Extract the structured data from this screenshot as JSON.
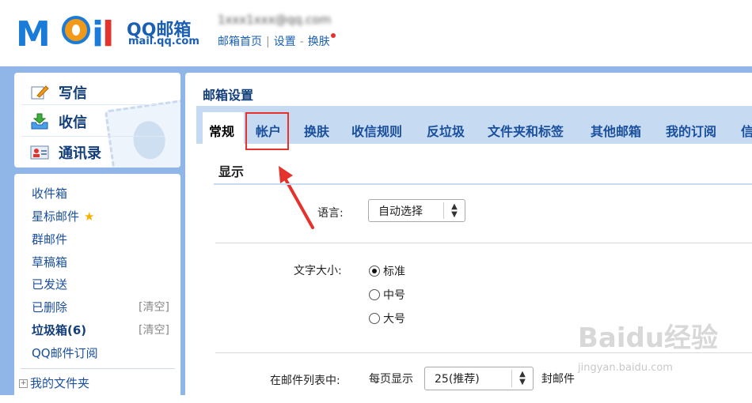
{
  "header": {
    "logo_text": "Mail",
    "brand_name": "QQ邮箱",
    "brand_domain": "mail.qq.com",
    "account": "1xxx1xxx@qq.com",
    "links": [
      "邮箱首页",
      "设置",
      "换肤"
    ]
  },
  "sidebar": {
    "quick": [
      {
        "label": "写信",
        "icon": "compose-icon"
      },
      {
        "label": "收信",
        "icon": "inbox-download-icon"
      },
      {
        "label": "通讯录",
        "icon": "contacts-icon"
      }
    ],
    "folders": [
      {
        "label": "收件箱"
      },
      {
        "label": "星标邮件"
      },
      {
        "label": "群邮件"
      },
      {
        "label": "草稿箱"
      },
      {
        "label": "已发送"
      },
      {
        "label": "已删除",
        "action": "[清空]"
      },
      {
        "label": "垃圾箱(6)",
        "action": "[清空]"
      },
      {
        "label": "QQ邮件订阅"
      }
    ],
    "my_folders": "我的文件夹"
  },
  "main": {
    "title": "邮箱设置",
    "tabs": [
      "常规",
      "帐户",
      "换肤",
      "收信规则",
      "反垃圾",
      "文件夹和标签",
      "其他邮箱",
      "我的订阅",
      "信"
    ],
    "active_tab": "常规",
    "highlighted_tab": "帐户",
    "section": "显示",
    "language": {
      "label": "语言:",
      "value": "自动选择"
    },
    "font_size": {
      "label": "文字大小:",
      "options": [
        "标准",
        "中号",
        "大号"
      ],
      "selected": "标准"
    },
    "mail_list": {
      "label": "在邮件列表中:",
      "prefix": "每页显示",
      "value": "25(推荐)",
      "suffix": "封邮件"
    }
  },
  "watermark": {
    "text": "Baidu经验",
    "sub": "jingyan.baidu.com"
  },
  "colors": {
    "accent_blue": "#1a5fb4",
    "frame": "#8fb6e6",
    "highlight_red": "#e5322d"
  }
}
